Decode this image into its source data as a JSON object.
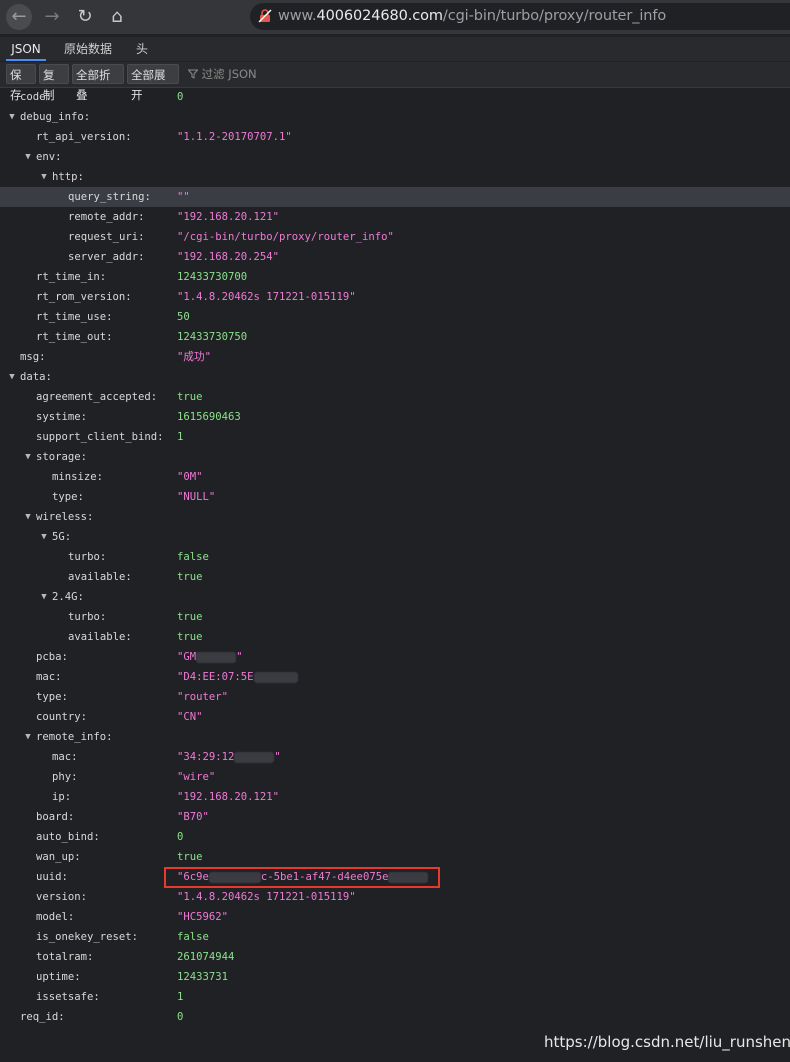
{
  "browser": {
    "url_prefix": "www.",
    "url_domain": "4006024680.com",
    "url_path": "/cgi-bin/turbo/proxy/router_info",
    "back_icon": "←",
    "forward_icon": "→",
    "reload_icon": "↻",
    "home_icon": "⌂"
  },
  "tabs": {
    "json": "JSON",
    "raw": "原始数据",
    "headers": "头"
  },
  "toolbar": {
    "save": "保存",
    "copy": "复制",
    "collapse_all": "全部折叠",
    "expand_all": "全部展开",
    "filter_icon": "filter-icon",
    "filter_placeholder": "过滤 JSON"
  },
  "tree": [
    {
      "key": "code:",
      "value": "0",
      "type": "num",
      "depth": 0
    },
    {
      "key": "debug_info:",
      "value": "",
      "type": "obj",
      "depth": 0
    },
    {
      "key": "rt_api_version:",
      "value": "\"1.1.2-20170707.1\"",
      "type": "str",
      "depth": 1
    },
    {
      "key": "env:",
      "value": "",
      "type": "obj",
      "depth": 1
    },
    {
      "key": "http:",
      "value": "",
      "type": "obj",
      "depth": 2
    },
    {
      "key": "query_string:",
      "value": "\"\"",
      "type": "str",
      "depth": 3,
      "highlight": true
    },
    {
      "key": "remote_addr:",
      "value": "\"192.168.20.121\"",
      "type": "str",
      "depth": 3
    },
    {
      "key": "request_uri:",
      "value": "\"/cgi-bin/turbo/proxy/router_info\"",
      "type": "str",
      "depth": 3
    },
    {
      "key": "server_addr:",
      "value": "\"192.168.20.254\"",
      "type": "str",
      "depth": 3
    },
    {
      "key": "rt_time_in:",
      "value": "12433730700",
      "type": "num",
      "depth": 1
    },
    {
      "key": "rt_rom_version:",
      "value": "\"1.4.8.20462s 171221-015119\"",
      "type": "str",
      "depth": 1
    },
    {
      "key": "rt_time_use:",
      "value": "50",
      "type": "num",
      "depth": 1
    },
    {
      "key": "rt_time_out:",
      "value": "12433730750",
      "type": "num",
      "depth": 1
    },
    {
      "key": "msg:",
      "value": "\"成功\"",
      "type": "str",
      "depth": 0
    },
    {
      "key": "data:",
      "value": "",
      "type": "obj",
      "depth": 0
    },
    {
      "key": "agreement_accepted:",
      "value": "true",
      "type": "bool",
      "depth": 1
    },
    {
      "key": "systime:",
      "value": "1615690463",
      "type": "num",
      "depth": 1
    },
    {
      "key": "support_client_bind:",
      "value": "1",
      "type": "num",
      "depth": 1
    },
    {
      "key": "storage:",
      "value": "",
      "type": "obj",
      "depth": 1
    },
    {
      "key": "minsize:",
      "value": "\"0M\"",
      "type": "str",
      "depth": 2
    },
    {
      "key": "type:",
      "value": "\"NULL\"",
      "type": "str",
      "depth": 2
    },
    {
      "key": "wireless:",
      "value": "",
      "type": "obj",
      "depth": 1
    },
    {
      "key": "5G:",
      "value": "",
      "type": "obj",
      "depth": 2
    },
    {
      "key": "turbo:",
      "value": "false",
      "type": "bool",
      "depth": 3
    },
    {
      "key": "available:",
      "value": "true",
      "type": "bool",
      "depth": 3
    },
    {
      "key": "2.4G:",
      "value": "",
      "type": "obj",
      "depth": 2
    },
    {
      "key": "turbo:",
      "value": "true",
      "type": "bool",
      "depth": 3
    },
    {
      "key": "available:",
      "value": "true",
      "type": "bool",
      "depth": 3
    },
    {
      "key": "pcba:",
      "value": "\"GM",
      "suffix": "\"",
      "type": "str",
      "depth": 1,
      "masked": "mid"
    },
    {
      "key": "mac:",
      "value": "\"D4:EE:07:5E",
      "type": "str",
      "depth": 1,
      "masked": "tail"
    },
    {
      "key": "type:",
      "value": "\"router\"",
      "type": "str",
      "depth": 1
    },
    {
      "key": "country:",
      "value": "\"CN\"",
      "type": "str",
      "depth": 1
    },
    {
      "key": "remote_info:",
      "value": "",
      "type": "obj",
      "depth": 1
    },
    {
      "key": "mac:",
      "value": "\"34:29:12",
      "suffix": "\"",
      "type": "str",
      "depth": 2,
      "masked": "mid"
    },
    {
      "key": "phy:",
      "value": "\"wire\"",
      "type": "str",
      "depth": 2
    },
    {
      "key": "ip:",
      "value": "\"192.168.20.121\"",
      "type": "str",
      "depth": 2
    },
    {
      "key": "board:",
      "value": "\"B70\"",
      "type": "str",
      "depth": 1
    },
    {
      "key": "auto_bind:",
      "value": "0",
      "type": "num",
      "depth": 1
    },
    {
      "key": "wan_up:",
      "value": "true",
      "type": "bool",
      "depth": 1
    },
    {
      "key": "uuid:",
      "value": "\"6c9e",
      "suffix": "c-5be1-af47-d4ee075e",
      "type": "str",
      "depth": 1,
      "masked": "uuid",
      "boxed": true
    },
    {
      "key": "version:",
      "value": "\"1.4.8.20462s 171221-015119\"",
      "type": "str",
      "depth": 1
    },
    {
      "key": "model:",
      "value": "\"HC5962\"",
      "type": "str",
      "depth": 1
    },
    {
      "key": "is_onekey_reset:",
      "value": "false",
      "type": "bool",
      "depth": 1
    },
    {
      "key": "totalram:",
      "value": "261074944",
      "type": "num",
      "depth": 1
    },
    {
      "key": "uptime:",
      "value": "12433731",
      "type": "num",
      "depth": 1
    },
    {
      "key": "issetsafe:",
      "value": "1",
      "type": "num",
      "depth": 1
    },
    {
      "key": "req_id:",
      "value": "0",
      "type": "num",
      "depth": 0
    }
  ],
  "watermark": "https://blog.csdn.net/liu_runsheng",
  "colors": {
    "string": "#f07ad8",
    "number": "#8ae28a",
    "highlight_box": "#e8392f",
    "tab_underline": "#4b8ef7"
  }
}
